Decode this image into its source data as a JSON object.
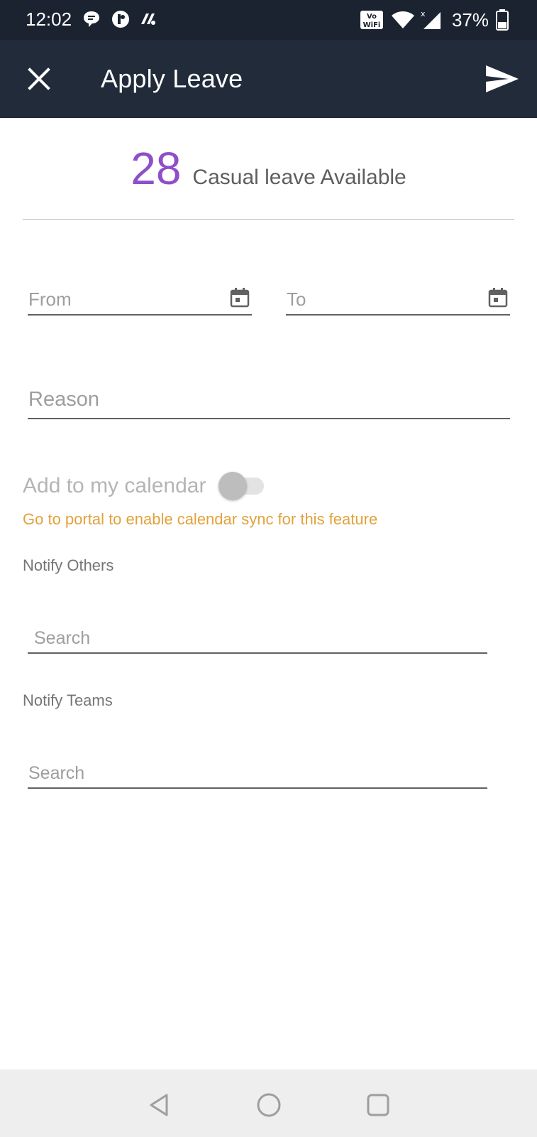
{
  "status_bar": {
    "time": "12:02",
    "battery": "37%",
    "icons": [
      "chat-bubble-icon",
      "app-badge-icon",
      "app-logo-icon",
      "vowifi-icon",
      "wifi-icon",
      "cell-signal-icon",
      "battery-icon"
    ]
  },
  "app_bar": {
    "title": "Apply Leave",
    "close_icon": "close-icon",
    "send_icon": "send-icon"
  },
  "leave_summary": {
    "count": "28",
    "label": "Casual leave Available",
    "count_color": "#8e4fc9"
  },
  "dates": {
    "from_placeholder": "From",
    "to_placeholder": "To",
    "icon": "calendar-icon"
  },
  "reason": {
    "placeholder": "Reason"
  },
  "calendar": {
    "label": "Add to my calendar",
    "enabled": false,
    "sync_note": "Go to portal to enable calendar sync for this feature",
    "sync_note_color": "#e3a13b"
  },
  "notify_others": {
    "label": "Notify Others",
    "search_placeholder": "Search"
  },
  "notify_teams": {
    "label": "Notify Teams",
    "search_placeholder": "Search"
  },
  "nav_bar": {
    "icons": [
      "back-icon",
      "home-icon",
      "recents-icon"
    ]
  },
  "colors": {
    "status_bar": "#1b2330",
    "app_bar": "#222b3a",
    "accent": "#8e4fc9",
    "warning": "#e3a13b"
  }
}
